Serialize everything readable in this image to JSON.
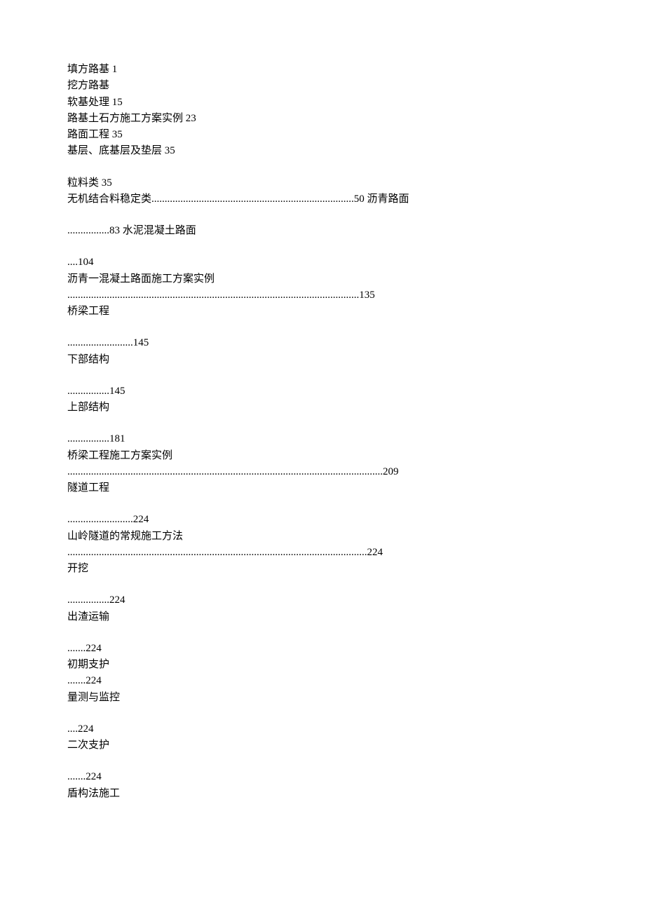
{
  "lines": [
    "填方路基 1",
    "挖方路基",
    "软基处理 15",
    "路基土石方施工方案实例 23",
    "路面工程 35",
    "基层、底基层及垫层 35",
    "",
    "粒料类 35",
    "无机结合料稳定类.............................................................................50 沥青路面",
    "",
    "................83 水泥混凝土路面",
    "",
    "....104",
    "沥青一混凝土路面施工方案实例",
    "...............................................................................................................135",
    "桥梁工程",
    "",
    ".........................145",
    "下部结构",
    "",
    "................145",
    "上部结构",
    "",
    "................181",
    "桥梁工程施工方案实例",
    "........................................................................................................................209",
    "隧道工程",
    "",
    ".........................224",
    "山岭隧道的常规施工方法",
    "..................................................................................................................224",
    "开挖",
    "",
    "................224",
    "出渣运输",
    "",
    ".......224",
    "初期支护",
    ".......224",
    "量测与监控",
    "",
    "....224",
    "二次支护",
    "",
    ".......224",
    "盾构法施工"
  ]
}
